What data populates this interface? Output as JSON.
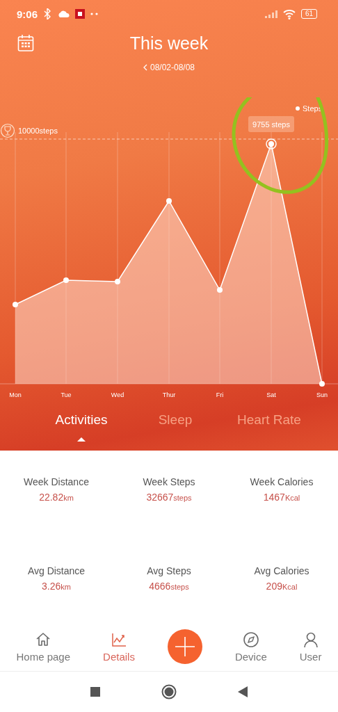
{
  "status_bar": {
    "time": "9:06",
    "battery": "61"
  },
  "header": {
    "title": "This week",
    "date_range": "08/02-08/08"
  },
  "chart": {
    "goal_label": "10000steps",
    "legend": "Steps",
    "tooltip": "9755 steps",
    "days": [
      "Mon",
      "Tue",
      "Wed",
      "Thur",
      "Fri",
      "Sat",
      "Sun"
    ]
  },
  "tabs": [
    {
      "label": "Activities",
      "selected": true
    },
    {
      "label": "Sleep",
      "selected": false
    },
    {
      "label": "Heart Rate",
      "selected": false
    }
  ],
  "stats": [
    {
      "label": "Week Distance",
      "value": "22.82",
      "unit": "km"
    },
    {
      "label": "Week Steps",
      "value": "32667",
      "unit": "steps"
    },
    {
      "label": "Week Calories",
      "value": "1467",
      "unit": "Kcal"
    },
    {
      "label": "Avg Distance",
      "value": "3.26",
      "unit": "km"
    },
    {
      "label": "Avg Steps",
      "value": "4666",
      "unit": "steps"
    },
    {
      "label": "Avg Calories",
      "value": "209",
      "unit": "Kcal"
    }
  ],
  "nav": [
    {
      "kind": "tab",
      "label": "Home page",
      "selected": false
    },
    {
      "kind": "tab",
      "label": "Details",
      "selected": true
    },
    {
      "kind": "add"
    },
    {
      "kind": "tab",
      "label": "Device",
      "selected": false
    },
    {
      "kind": "tab",
      "label": "User",
      "selected": false
    }
  ]
}
